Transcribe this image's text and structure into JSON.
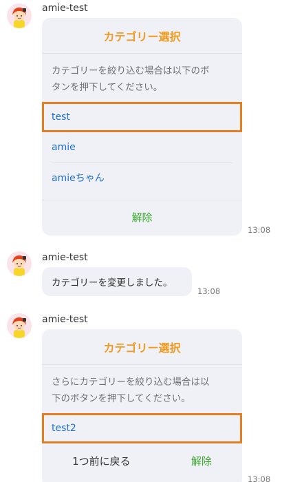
{
  "messages": [
    {
      "sender": "amie-test",
      "card": {
        "title": "カテゴリー選択",
        "description_lines": [
          "カテゴリーを絞り込む場合は以下のボ",
          "タンを押下してください。"
        ],
        "options": [
          "test",
          "amie",
          "amieちゃん"
        ],
        "footer": "解除"
      },
      "time": "13:08"
    },
    {
      "sender": "amie-test",
      "text": "カテゴリーを変更しました。",
      "time": "13:08"
    },
    {
      "sender": "amie-test",
      "card": {
        "title": "カテゴリー選択",
        "description_lines": [
          "さらにカテゴリーを絞り込む場合は以",
          "下のボタンを押下してください。"
        ],
        "options": [
          "test2"
        ],
        "footer_left": "1つ前に戻る",
        "footer_right": "解除"
      },
      "time": "13:08"
    }
  ],
  "colors": {
    "title": "#f29a1f",
    "option": "#1f6fd0",
    "action": "#35a82a",
    "highlight": "#e67e22",
    "card_bg": "#f0f1f6"
  },
  "icons": [
    "bot-avatar"
  ]
}
